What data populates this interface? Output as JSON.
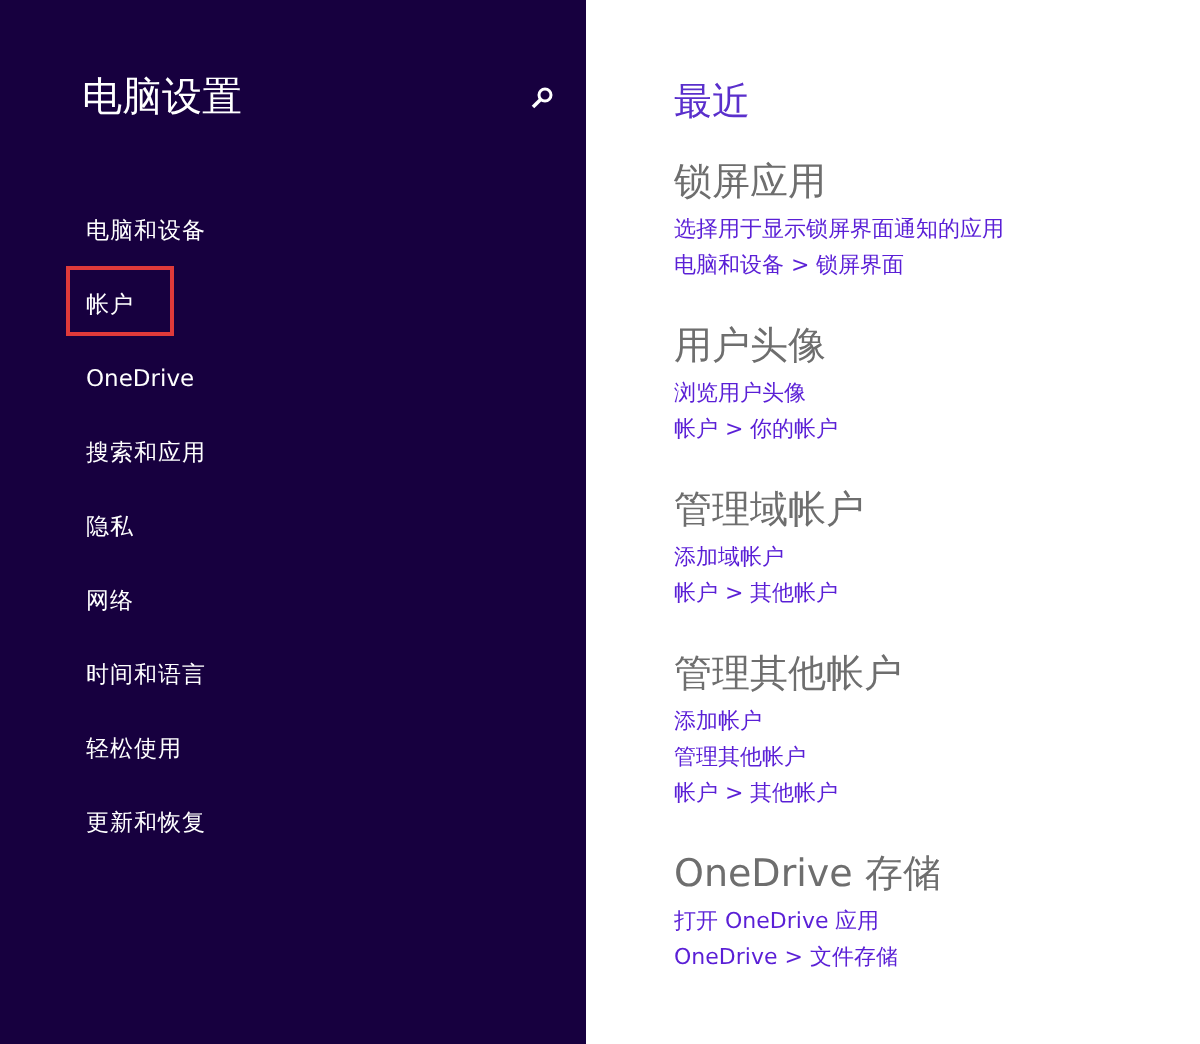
{
  "sidebar": {
    "title": "电脑设置",
    "items": [
      {
        "label": "电脑和设备",
        "selected": false
      },
      {
        "label": "帐户",
        "selected": true
      },
      {
        "label": "OneDrive",
        "selected": false
      },
      {
        "label": "搜索和应用",
        "selected": false
      },
      {
        "label": "隐私",
        "selected": false
      },
      {
        "label": "网络",
        "selected": false
      },
      {
        "label": "时间和语言",
        "selected": false
      },
      {
        "label": "轻松使用",
        "selected": false
      },
      {
        "label": "更新和恢复",
        "selected": false
      }
    ]
  },
  "content": {
    "title": "最近",
    "sections": [
      {
        "heading": "锁屏应用",
        "links": [
          "选择用于显示锁屏界面通知的应用",
          "电脑和设备 > 锁屏界面"
        ]
      },
      {
        "heading": "用户头像",
        "links": [
          "浏览用户头像",
          "帐户 > 你的帐户"
        ]
      },
      {
        "heading": "管理域帐户",
        "links": [
          "添加域帐户",
          "帐户 > 其他帐户"
        ]
      },
      {
        "heading": "管理其他帐户",
        "links": [
          "添加帐户",
          "管理其他帐户",
          "帐户 > 其他帐户"
        ]
      },
      {
        "heading": "OneDrive 存储",
        "links": [
          "打开 OneDrive 应用",
          "OneDrive > 文件存储"
        ]
      }
    ]
  }
}
